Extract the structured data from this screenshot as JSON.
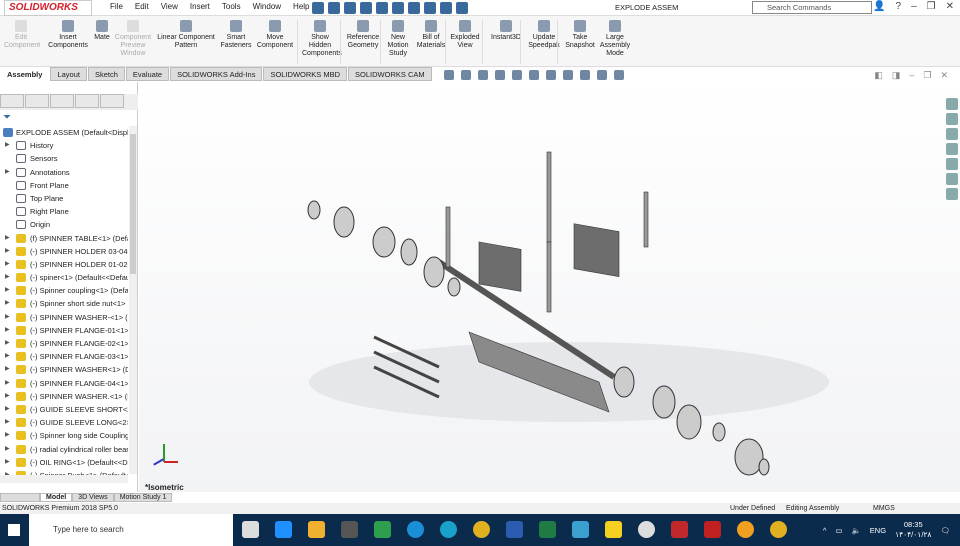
{
  "app": {
    "logo": "SOLIDWORKS",
    "title": "EXPLODE ASSEM",
    "search_placeholder": "Search Commands"
  },
  "menu": [
    "File",
    "Edit",
    "View",
    "Insert",
    "Tools",
    "Window",
    "Help"
  ],
  "ribbon": [
    {
      "label": "Edit Component",
      "disabled": true
    },
    {
      "label": "Insert Components",
      "disabled": false
    },
    {
      "label": "Mate",
      "disabled": false
    },
    {
      "label": "Component Preview Window",
      "disabled": true
    },
    {
      "label": "Linear Component Pattern",
      "disabled": false
    },
    {
      "label": "Smart Fasteners",
      "disabled": false
    },
    {
      "label": "Move Component",
      "disabled": false
    },
    {
      "label": "Show Hidden Components",
      "disabled": false
    },
    {
      "label": "Reference Geometry",
      "disabled": false
    },
    {
      "label": "New Motion Study",
      "disabled": false
    },
    {
      "label": "Bill of Materials",
      "disabled": false
    },
    {
      "label": "Exploded View",
      "disabled": false
    },
    {
      "label": "Instant3D",
      "disabled": false
    },
    {
      "label": "Update Speedpak",
      "disabled": false
    },
    {
      "label": "Take Snapshot",
      "disabled": false
    },
    {
      "label": "Large Assembly Mode",
      "disabled": false
    }
  ],
  "tabs": [
    "Assembly",
    "Layout",
    "Sketch",
    "Evaluate",
    "SOLIDWORKS Add-Ins",
    "SOLIDWORKS MBD",
    "SOLIDWORKS CAM"
  ],
  "tree": {
    "root": "EXPLODE ASSEM  (Default<Display",
    "items": [
      {
        "label": "History",
        "arrow": true,
        "type": "f"
      },
      {
        "label": "Sensors",
        "arrow": false,
        "type": "f"
      },
      {
        "label": "Annotations",
        "arrow": true,
        "type": "f"
      },
      {
        "label": "Front Plane",
        "arrow": false,
        "type": "f"
      },
      {
        "label": "Top Plane",
        "arrow": false,
        "type": "f"
      },
      {
        "label": "Right Plane",
        "arrow": false,
        "type": "f"
      },
      {
        "label": "Origin",
        "arrow": false,
        "type": "f"
      },
      {
        "label": "(f) SPINNER TABLE<1> (Default",
        "arrow": true,
        "type": "c"
      },
      {
        "label": "(-) SPINNER HOLDER 03-04<1>",
        "arrow": true,
        "type": "c"
      },
      {
        "label": "(-) SPINNER HOLDER 01-02<1>",
        "arrow": true,
        "type": "c"
      },
      {
        "label": "(-) spiner<1> (Default<<Defau",
        "arrow": true,
        "type": "c"
      },
      {
        "label": "(-) Spinner coupling<1> (Defau",
        "arrow": true,
        "type": "c"
      },
      {
        "label": "(-) Spinner short side nut<1> (",
        "arrow": true,
        "type": "c"
      },
      {
        "label": "(-) SPINNER WASHER-<1> (De",
        "arrow": true,
        "type": "c"
      },
      {
        "label": "(-) SPINNER FLANGE-01<1> (D",
        "arrow": true,
        "type": "c"
      },
      {
        "label": "(-) SPINNER FLANGE-02<1> (D",
        "arrow": true,
        "type": "c"
      },
      {
        "label": "(-) SPINNER FLANGE-03<1> (D",
        "arrow": true,
        "type": "c"
      },
      {
        "label": "(-) SPINNER WASHER<1> (Def",
        "arrow": true,
        "type": "c"
      },
      {
        "label": "(-) SPINNER FLANGE-04<1> (D",
        "arrow": true,
        "type": "c"
      },
      {
        "label": "(-) SPINNER WASHER.<1> (Def",
        "arrow": true,
        "type": "c"
      },
      {
        "label": "(-) GUIDE SLEEVE SHORT<2> (D",
        "arrow": true,
        "type": "c"
      },
      {
        "label": "(-) GUIDE SLEEVE LONG<2> (D",
        "arrow": true,
        "type": "c"
      },
      {
        "label": "(-) Spinner long side Coupling",
        "arrow": true,
        "type": "c"
      },
      {
        "label": "(-) radial cylindrical roller beari",
        "arrow": true,
        "type": "c"
      },
      {
        "label": "(-) OIL RING<1> (Default<<De",
        "arrow": true,
        "type": "c"
      },
      {
        "label": "(-) Spinner Bush<1> (Default<",
        "arrow": true,
        "type": "c"
      }
    ]
  },
  "bottom_tabs": [
    "Model",
    "3D Views",
    "Motion Study 1"
  ],
  "viewport": {
    "view_label": "*Isometric"
  },
  "status": {
    "product": "SOLIDWORKS Premium 2018 SP5.0",
    "state": "Under Defined",
    "mode": "Editing Assembly",
    "units": "MMGS"
  },
  "taskbar": {
    "search_placeholder": "Type here to search",
    "lang": "ENG",
    "time": "08:35",
    "date": "۱۴۰۴/۰۱/۲۸"
  },
  "colors": {
    "accent": "#d6202a",
    "taskbar": "#0b2b4c"
  }
}
